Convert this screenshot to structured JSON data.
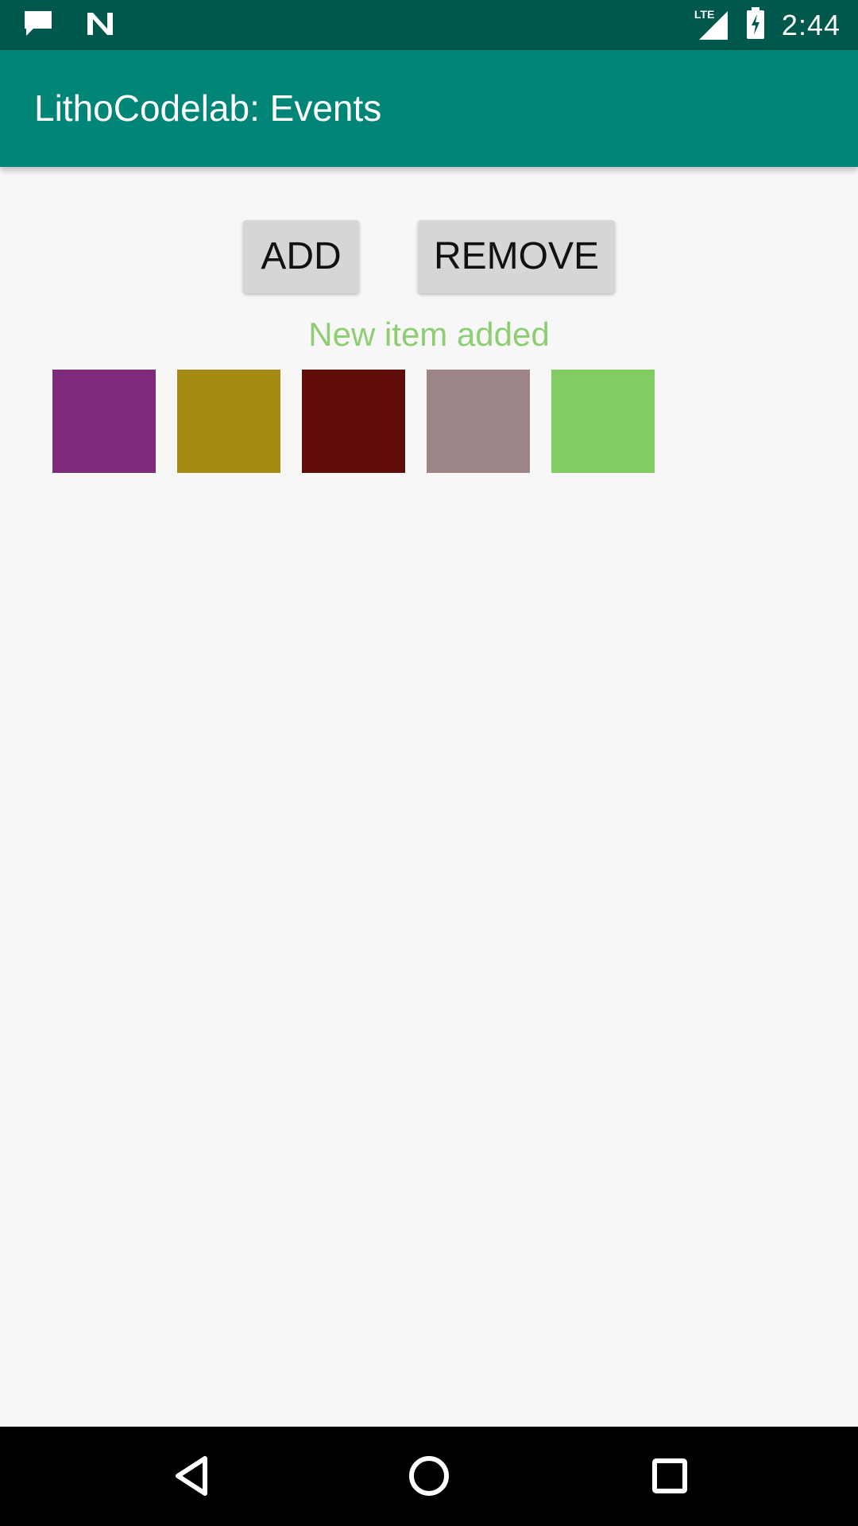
{
  "status_bar": {
    "time": "2:44",
    "network_label": "LTE",
    "icons": [
      "message-icon",
      "n-logo-icon",
      "signal-icon",
      "battery-charging-icon"
    ]
  },
  "app_bar": {
    "title": "LithoCodelab: Events"
  },
  "actions": {
    "add_label": "ADD",
    "remove_label": "REMOVE"
  },
  "status_message": "New item added",
  "items": [
    {
      "color": "#7d2b7a"
    },
    {
      "color": "#a48c14"
    },
    {
      "color": "#5f0c0a"
    },
    {
      "color": "#9d8487"
    },
    {
      "color": "#82cd62"
    }
  ],
  "nav": {
    "icons": [
      "back-icon",
      "home-icon",
      "recents-icon"
    ]
  },
  "colors": {
    "app_bar": "#008577",
    "status_bar": "#00574b",
    "message": "#8fcd73"
  }
}
